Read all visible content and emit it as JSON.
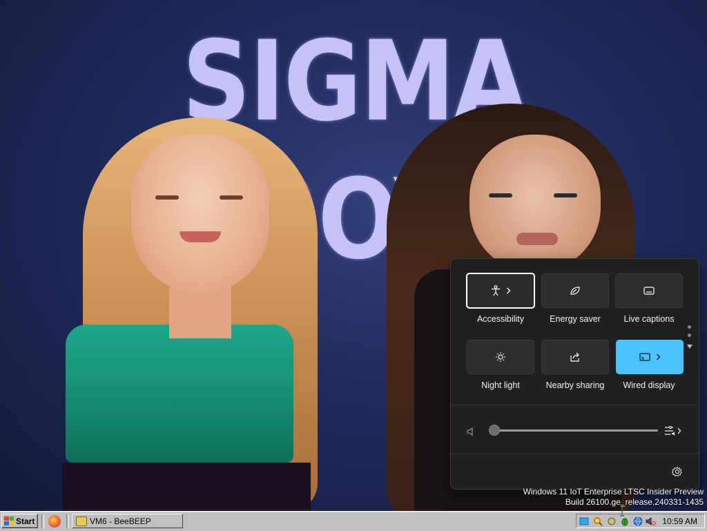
{
  "wallpaper": {
    "title": "SIGMA BOY"
  },
  "quick_settings": {
    "tiles": [
      {
        "label": "Accessibility",
        "icon": "accessibility-icon",
        "has_chevron": true,
        "state": "focused"
      },
      {
        "label": "Energy saver",
        "icon": "leaf-icon",
        "has_chevron": false,
        "state": "off"
      },
      {
        "label": "Live captions",
        "icon": "captions-icon",
        "has_chevron": false,
        "state": "off"
      },
      {
        "label": "Night light",
        "icon": "sun-icon",
        "has_chevron": false,
        "state": "off"
      },
      {
        "label": "Nearby sharing",
        "icon": "share-icon",
        "has_chevron": false,
        "state": "off"
      },
      {
        "label": "Wired display",
        "icon": "cast-icon",
        "has_chevron": true,
        "state": "on"
      }
    ],
    "volume": {
      "level": 0,
      "icon": "speaker-muted-icon",
      "mixer_icon": "volume-mixer-icon"
    },
    "footer": {
      "settings_icon": "gear-icon"
    },
    "colors": {
      "panel": "#202020",
      "tile": "#2d2d2d",
      "accent": "#4cc2ff"
    }
  },
  "watermark": {
    "line1": "Windows 11 IoT Enterprise LTSC Insider Preview",
    "line2": "Build 26100.ge_release.240331-1435"
  },
  "taskbar": {
    "start_label": "Start",
    "quicklaunch_icon": "firefox-icon",
    "tasks": [
      {
        "label": "VM6 - BeeBEEP",
        "icon": "beebeep-icon"
      }
    ],
    "tray_icons": [
      "folder-icon",
      "search-icon",
      "gear-icon",
      "bug-icon",
      "network-icon",
      "volume-muted-icon"
    ],
    "clock": "10:59 AM"
  }
}
